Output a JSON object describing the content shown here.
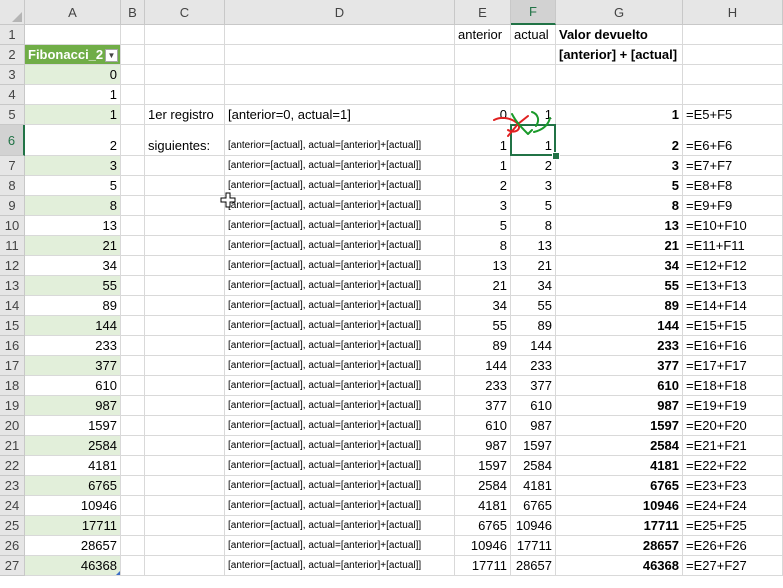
{
  "columns": [
    "A",
    "B",
    "C",
    "D",
    "E",
    "F",
    "G",
    "H"
  ],
  "selected_column": "F",
  "selected_row": "6",
  "header_rows": [
    {
      "row": "1",
      "E": "anterior",
      "F": "actual",
      "G": "Valor devuelto"
    },
    {
      "row": "2",
      "A": "Fibonacci_2",
      "G": "[anterior] + [actual]"
    }
  ],
  "rows": [
    {
      "row": "3",
      "A": "0"
    },
    {
      "row": "4",
      "A": "1"
    },
    {
      "row": "5",
      "A": "1",
      "C": "1er registro",
      "D": "[anterior=0, actual=1]",
      "E": "0",
      "F": "1",
      "G": "1",
      "H": "=E5+F5"
    },
    {
      "row": "6",
      "A": "2",
      "C": "siguientes:",
      "D": "[anterior=[actual], actual=[anterior]+[actual]]",
      "E": "1",
      "F": "1",
      "G": "2",
      "H": "=E6+F6"
    },
    {
      "row": "7",
      "A": "3",
      "D": "[anterior=[actual], actual=[anterior]+[actual]]",
      "E": "1",
      "F": "2",
      "G": "3",
      "H": "=E7+F7"
    },
    {
      "row": "8",
      "A": "5",
      "D": "[anterior=[actual], actual=[anterior]+[actual]]",
      "E": "2",
      "F": "3",
      "G": "5",
      "H": "=E8+F8"
    },
    {
      "row": "9",
      "A": "8",
      "D": "[anterior=[actual], actual=[anterior]+[actual]]",
      "E": "3",
      "F": "5",
      "G": "8",
      "H": "=E9+F9"
    },
    {
      "row": "10",
      "A": "13",
      "D": "[anterior=[actual], actual=[anterior]+[actual]]",
      "E": "5",
      "F": "8",
      "G": "13",
      "H": "=E10+F10"
    },
    {
      "row": "11",
      "A": "21",
      "D": "[anterior=[actual], actual=[anterior]+[actual]]",
      "E": "8",
      "F": "13",
      "G": "21",
      "H": "=E11+F11"
    },
    {
      "row": "12",
      "A": "34",
      "D": "[anterior=[actual], actual=[anterior]+[actual]]",
      "E": "13",
      "F": "21",
      "G": "34",
      "H": "=E12+F12"
    },
    {
      "row": "13",
      "A": "55",
      "D": "[anterior=[actual], actual=[anterior]+[actual]]",
      "E": "21",
      "F": "34",
      "G": "55",
      "H": "=E13+F13"
    },
    {
      "row": "14",
      "A": "89",
      "D": "[anterior=[actual], actual=[anterior]+[actual]]",
      "E": "34",
      "F": "55",
      "G": "89",
      "H": "=E14+F14"
    },
    {
      "row": "15",
      "A": "144",
      "D": "[anterior=[actual], actual=[anterior]+[actual]]",
      "E": "55",
      "F": "89",
      "G": "144",
      "H": "=E15+F15"
    },
    {
      "row": "16",
      "A": "233",
      "D": "[anterior=[actual], actual=[anterior]+[actual]]",
      "E": "89",
      "F": "144",
      "G": "233",
      "H": "=E16+F16"
    },
    {
      "row": "17",
      "A": "377",
      "D": "[anterior=[actual], actual=[anterior]+[actual]]",
      "E": "144",
      "F": "233",
      "G": "377",
      "H": "=E17+F17"
    },
    {
      "row": "18",
      "A": "610",
      "D": "[anterior=[actual], actual=[anterior]+[actual]]",
      "E": "233",
      "F": "377",
      "G": "610",
      "H": "=E18+F18"
    },
    {
      "row": "19",
      "A": "987",
      "D": "[anterior=[actual], actual=[anterior]+[actual]]",
      "E": "377",
      "F": "610",
      "G": "987",
      "H": "=E19+F19"
    },
    {
      "row": "20",
      "A": "1597",
      "D": "[anterior=[actual], actual=[anterior]+[actual]]",
      "E": "610",
      "F": "987",
      "G": "1597",
      "H": "=E20+F20"
    },
    {
      "row": "21",
      "A": "2584",
      "D": "[anterior=[actual], actual=[anterior]+[actual]]",
      "E": "987",
      "F": "1597",
      "G": "2584",
      "H": "=E21+F21"
    },
    {
      "row": "22",
      "A": "4181",
      "D": "[anterior=[actual], actual=[anterior]+[actual]]",
      "E": "1597",
      "F": "2584",
      "G": "4181",
      "H": "=E22+F22"
    },
    {
      "row": "23",
      "A": "6765",
      "D": "[anterior=[actual], actual=[anterior]+[actual]]",
      "E": "2584",
      "F": "4181",
      "G": "6765",
      "H": "=E23+F23"
    },
    {
      "row": "24",
      "A": "10946",
      "D": "[anterior=[actual], actual=[anterior]+[actual]]",
      "E": "4181",
      "F": "6765",
      "G": "10946",
      "H": "=E24+F24"
    },
    {
      "row": "25",
      "A": "17711",
      "D": "[anterior=[actual], actual=[anterior]+[actual]]",
      "E": "6765",
      "F": "10946",
      "G": "17711",
      "H": "=E25+F25"
    },
    {
      "row": "26",
      "A": "28657",
      "D": "[anterior=[actual], actual=[anterior]+[actual]]",
      "E": "10946",
      "F": "17711",
      "G": "28657",
      "H": "=E26+F26"
    },
    {
      "row": "27",
      "A": "46368",
      "D": "[anterior=[actual], actual=[anterior]+[actual]]",
      "E": "17711",
      "F": "28657",
      "G": "46368",
      "H": "=E27+F27"
    }
  ],
  "colors": {
    "table_header_fill": "#70ad47",
    "band_fill": "#e2efda",
    "selection": "#217346",
    "annotation_red": "#e02020",
    "annotation_green": "#1a9a2a"
  },
  "icons": {
    "filter_dropdown": "filter-dropdown-icon",
    "cursor": "cell-cursor-icon"
  }
}
